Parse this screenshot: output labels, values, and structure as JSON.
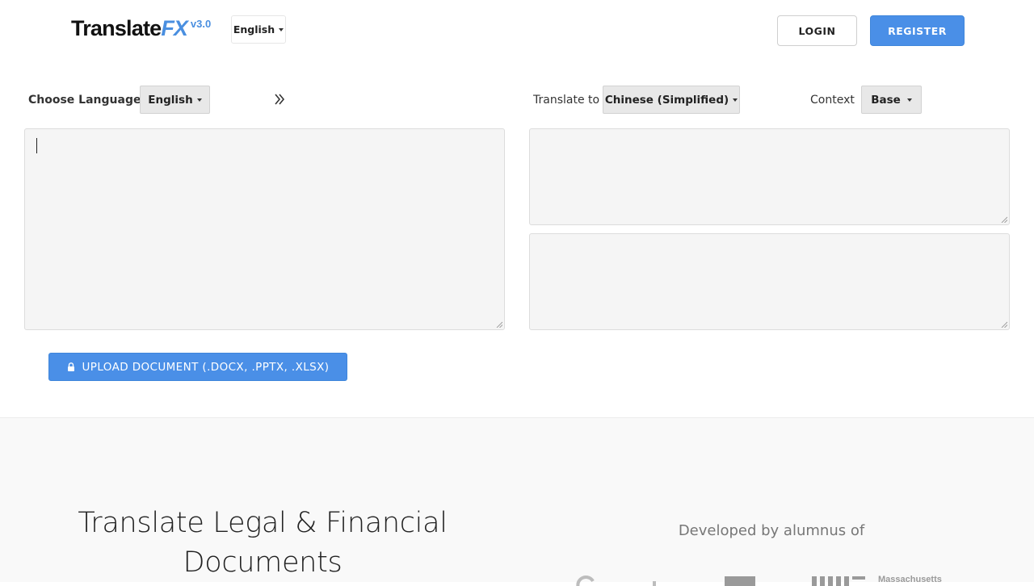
{
  "header": {
    "logo_main": "Translate",
    "logo_accent": "FX",
    "logo_version": "v3.0",
    "ui_language": "English",
    "login_label": "LOGIN",
    "register_label": "REGISTER"
  },
  "translator": {
    "source_label": "Choose Language:",
    "source_language": "English",
    "target_label": "Translate to",
    "target_language": "Chinese (Simplified)",
    "context_label": "Context",
    "context_value": "Base",
    "source_text": "",
    "output_text": "",
    "secondary_output_text": "",
    "upload_label": "UPLOAD DOCUMENT (.DOCX, .PPTX, .XLSX)"
  },
  "marketing": {
    "headline_line1": "Translate Legal & Financial",
    "headline_line2": "Documents",
    "developed_by": "Developed by alumnus of",
    "alumni_logo_text": "Massachusetts"
  },
  "colors": {
    "accent": "#4a8fe7",
    "textarea_bg": "#f5f5f5",
    "dropdown_bg": "#e8e8e8"
  }
}
